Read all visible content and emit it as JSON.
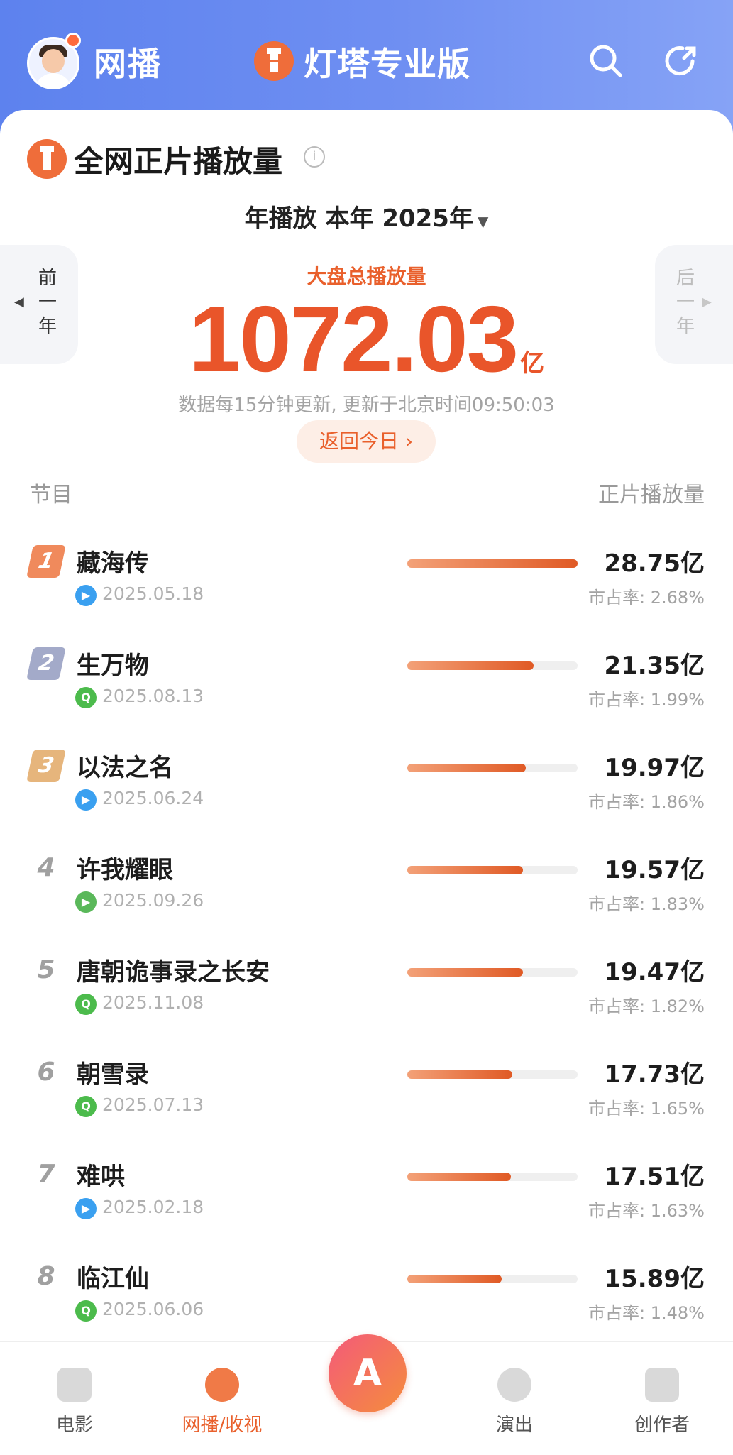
{
  "header": {
    "app_name": "网播",
    "brand_title": "灯塔专业版"
  },
  "section": {
    "title": "全网正片播放量",
    "period": "年播放  本年 2025年"
  },
  "nav": {
    "prev_label": "前一年",
    "next_label": "后一年"
  },
  "summary": {
    "label": "大盘总播放量",
    "value": "1072.03",
    "unit": "亿",
    "update_note": "数据每15分钟更新, 更新于北京时间09:50:03",
    "back_today": "返回今日 ›"
  },
  "columns": {
    "program": "节目",
    "plays": "正片播放量"
  },
  "rows": [
    {
      "rank": "1",
      "title": "藏海传",
      "platform": "youku",
      "date": "2025.05.18",
      "plays": "28.75亿",
      "share": "市占率: 2.68%",
      "value": 28.75
    },
    {
      "rank": "2",
      "title": "生万物",
      "platform": "iqiyi",
      "date": "2025.08.13",
      "plays": "21.35亿",
      "share": "市占率: 1.99%",
      "value": 21.35
    },
    {
      "rank": "3",
      "title": "以法之名",
      "platform": "youku",
      "date": "2025.06.24",
      "plays": "19.97亿",
      "share": "市占率: 1.86%",
      "value": 19.97
    },
    {
      "rank": "4",
      "title": "许我耀眼",
      "platform": "tencent",
      "date": "2025.09.26",
      "plays": "19.57亿",
      "share": "市占率: 1.83%",
      "value": 19.57
    },
    {
      "rank": "5",
      "title": "唐朝诡事录之长安",
      "platform": "iqiyi",
      "date": "2025.11.08",
      "plays": "19.47亿",
      "share": "市占率: 1.82%",
      "value": 19.47
    },
    {
      "rank": "6",
      "title": "朝雪录",
      "platform": "iqiyi",
      "date": "2025.07.13",
      "plays": "17.73亿",
      "share": "市占率: 1.65%",
      "value": 17.73
    },
    {
      "rank": "7",
      "title": "难哄",
      "platform": "youku",
      "date": "2025.02.18",
      "plays": "17.51亿",
      "share": "市占率: 1.63%",
      "value": 17.51
    },
    {
      "rank": "8",
      "title": "临江仙",
      "platform": "iqiyi",
      "date": "2025.06.06",
      "plays": "15.89亿",
      "share": "市占率: 1.48%",
      "value": 15.89
    }
  ],
  "bottom_nav": {
    "movie": "电影",
    "stream": "网播/收视",
    "ai": "A",
    "show": "演出",
    "more": "创作者"
  },
  "colors": {
    "accent": "#e9602c",
    "header_blue": "#6f8ff2"
  }
}
